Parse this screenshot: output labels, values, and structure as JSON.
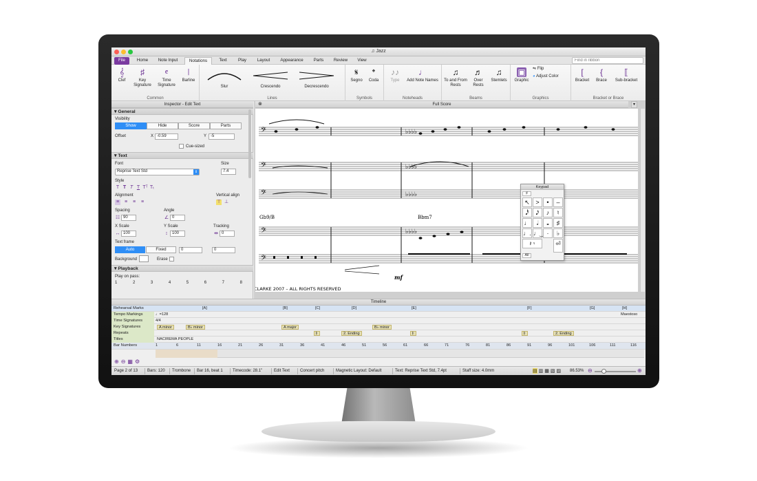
{
  "window": {
    "title": "Jazz"
  },
  "ribbon_tabs": [
    "File",
    "Home",
    "Note Input",
    "Notations",
    "Text",
    "Play",
    "Layout",
    "Appearance",
    "Parts",
    "Review",
    "View"
  ],
  "ribbon_search_placeholder": "Find in ribbon",
  "ribbon": {
    "common": {
      "title": "Common",
      "buttons": [
        "Clef",
        "Key Signature",
        "Time Signature",
        "Barline"
      ]
    },
    "lines": {
      "title": "Lines",
      "items": [
        "Slur",
        "Crescendo",
        "Decrescendo"
      ]
    },
    "symbols": {
      "title": "Symbols",
      "buttons": [
        "Segno",
        "Coda"
      ]
    },
    "noteheads": {
      "title": "Noteheads",
      "buttons": [
        "Type",
        "Add Note Names"
      ]
    },
    "beams": {
      "title": "Beams",
      "buttons": [
        "To and From Rests",
        "Over Rests",
        "Stemlets"
      ]
    },
    "graphics": {
      "title": "Graphics",
      "buttons": [
        "Graphic",
        "Flip",
        "Adjust Color"
      ]
    },
    "bracket": {
      "title": "Bracket or Brace",
      "buttons": [
        "Bracket",
        "Brace",
        "Sub-bracket"
      ]
    }
  },
  "inspector": {
    "title": "Inspector - Edit Text",
    "general": {
      "heading": "General",
      "visibility_label": "Visibility",
      "visibility_options": [
        "Show",
        "Hide",
        "Score",
        "Parts"
      ],
      "offset_label": "Offset",
      "x_label": "X",
      "x_value": "-0.59",
      "y_label": "Y",
      "y_value": "-5",
      "cue_sized_label": "Cue-sized"
    },
    "text": {
      "heading": "Text",
      "font_label": "Font",
      "font_value": "Reprise Text Std",
      "size_label": "Size",
      "size_value": "7.4",
      "style_label": "Style",
      "alignment_label": "Alignment",
      "valign_label": "Vertical align",
      "spacing_label": "Spacing",
      "spacing_value": "90",
      "angle_label": "Angle",
      "angle_value": "0",
      "xscale_label": "X Scale",
      "xscale_value": "100",
      "yscale_label": "Y Scale",
      "yscale_value": "100",
      "tracking_label": "Tracking",
      "tracking_value": "0",
      "frame_label": "Text frame",
      "frame_options": [
        "Auto",
        "Fixed"
      ],
      "frame_v1": "0",
      "frame_v2": "0",
      "background_label": "Background",
      "erase_label": "Erase"
    },
    "playback": {
      "heading": "Playback",
      "play_on_pass_label": "Play on pass:",
      "passes": [
        "1",
        "2",
        "3",
        "4",
        "5",
        "6",
        "7",
        "8"
      ]
    }
  },
  "score": {
    "tab_title": "Full Score",
    "chord1": "Gb9/B",
    "chord2": "Bbm7",
    "dynamic": "mf",
    "copyright": "CLARKE 2007 – ALL RIGHTS RESERVED"
  },
  "keypad": {
    "title": "Keypad",
    "layouts": [
      "1",
      "2",
      "3",
      "4",
      "All"
    ]
  },
  "timeline": {
    "title": "Timeline",
    "rows": [
      {
        "name": "Rehearsal Marks",
        "items": [
          "[A]",
          "[B]",
          "[C]",
          "[D]",
          "[E]",
          "[F]",
          "[G]",
          "[H]"
        ]
      },
      {
        "name": "Tempo Markings",
        "items": [
          "♩=128",
          "Maestoso"
        ]
      },
      {
        "name": "Time Signatures",
        "items": [
          "4/4"
        ]
      },
      {
        "name": "Key Signatures",
        "items": [
          "A minor",
          "B♭ minor",
          "A major",
          "B♭ minor"
        ]
      },
      {
        "name": "Repeats",
        "items": [
          "2. Ending",
          "2. Ending"
        ]
      },
      {
        "name": "Titles",
        "items": [
          "NACIREMA PEOPLE"
        ]
      },
      {
        "name": "Bar Numbers",
        "items": [
          "1",
          "6",
          "11",
          "16",
          "21",
          "26",
          "31",
          "36",
          "41",
          "46",
          "51",
          "56",
          "61",
          "66",
          "71",
          "76",
          "81",
          "86",
          "91",
          "96",
          "101",
          "106",
          "111",
          "116"
        ]
      }
    ]
  },
  "status": {
    "page": "Page 2 of 13",
    "bars": "Bars: 120",
    "instrument": "Trombone",
    "position": "Bar 16, beat 1",
    "timecode": "Timecode: 28.1\"",
    "mode": "Edit Text",
    "pitch": "Concert pitch",
    "magnetic": "Magnetic Layout: Default",
    "text_style": "Text: Reprise Text Std, 7.4pt",
    "staff_size": "Staff size: 4.0mm",
    "zoom": "86.53%"
  }
}
